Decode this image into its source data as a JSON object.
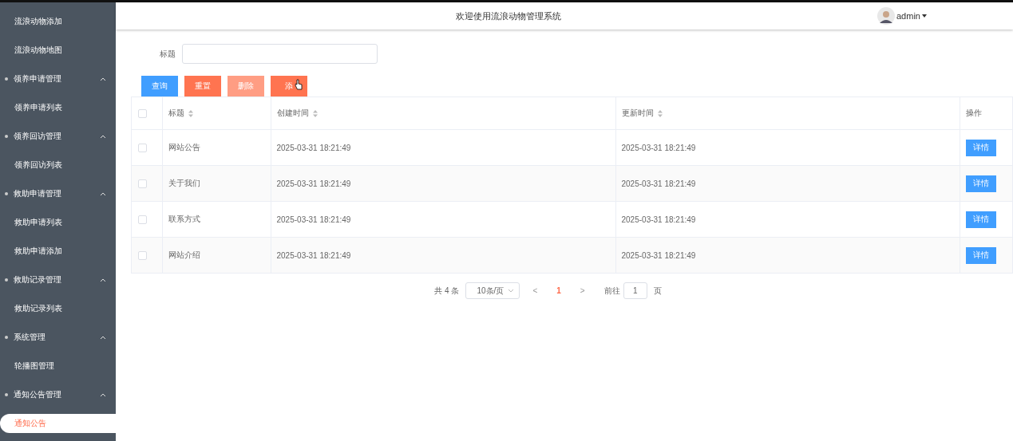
{
  "header": {
    "title": "欢迎使用流浪动物管理系统",
    "user": "admin"
  },
  "sidebar": {
    "items": [
      {
        "kind": "link",
        "label": "流浪动物添加",
        "selected": false
      },
      {
        "kind": "link",
        "label": "流浪动物地图",
        "selected": false
      },
      {
        "kind": "group",
        "label": "领养申请管理",
        "expanded": true,
        "children": [
          {
            "kind": "link",
            "label": "领养申请列表",
            "selected": false
          }
        ]
      },
      {
        "kind": "group",
        "label": "领养回访管理",
        "expanded": true,
        "children": [
          {
            "kind": "link",
            "label": "领养回访列表",
            "selected": false
          }
        ]
      },
      {
        "kind": "group",
        "label": "救助申请管理",
        "expanded": true,
        "children": [
          {
            "kind": "link",
            "label": "救助申请列表",
            "selected": false
          },
          {
            "kind": "link",
            "label": "救助申请添加",
            "selected": false
          }
        ]
      },
      {
        "kind": "group",
        "label": "救助记录管理",
        "expanded": true,
        "children": [
          {
            "kind": "link",
            "label": "救助记录列表",
            "selected": false
          }
        ]
      },
      {
        "kind": "group",
        "label": "系统管理",
        "expanded": true,
        "children": [
          {
            "kind": "link",
            "label": "轮播图管理",
            "selected": false
          }
        ]
      },
      {
        "kind": "group",
        "label": "通知公告管理",
        "expanded": true,
        "children": [
          {
            "kind": "link",
            "label": "通知公告",
            "selected": true
          }
        ]
      }
    ]
  },
  "search": {
    "label": "标题"
  },
  "buttons": [
    {
      "label": "查询",
      "kind": "primary",
      "disabled": false
    },
    {
      "label": "重置",
      "kind": "danger",
      "disabled": false
    },
    {
      "label": "删除",
      "kind": "danger",
      "disabled": true
    },
    {
      "label": "添",
      "kind": "danger",
      "disabled": false
    }
  ],
  "table": {
    "select_all": {
      "checked": false
    },
    "columns": [
      {
        "kind": "text",
        "label": "标题",
        "sortable": true
      },
      {
        "kind": "text",
        "label": "创建时间",
        "sortable": true
      },
      {
        "kind": "text",
        "label": "更新时间",
        "sortable": true
      },
      {
        "kind": "action",
        "label": "操作",
        "sortable": false
      }
    ],
    "rows": [
      {
        "checked": false,
        "cells": [
          "网站公告",
          "2025-03-31 18:21:49",
          "2025-03-31 18:21:49",
          "详情"
        ]
      },
      {
        "checked": false,
        "cells": [
          "关于我们",
          "2025-03-31 18:21:49",
          "2025-03-31 18:21:49",
          "详情"
        ]
      },
      {
        "checked": false,
        "cells": [
          "联系方式",
          "2025-03-31 18:21:49",
          "2025-03-31 18:21:49",
          "详情"
        ]
      },
      {
        "checked": false,
        "cells": [
          "网站介绍",
          "2025-03-31 18:21:49",
          "2025-03-31 18:21:49",
          "详情"
        ]
      }
    ]
  },
  "pagination": {
    "total": "共 4 条",
    "page_size": "10条/页",
    "prev": "<",
    "pages": [
      {
        "label": "1",
        "selected": true
      }
    ],
    "next": ">",
    "jump_label": "前往",
    "jump_value": "1",
    "jump_suffix": "页"
  }
}
